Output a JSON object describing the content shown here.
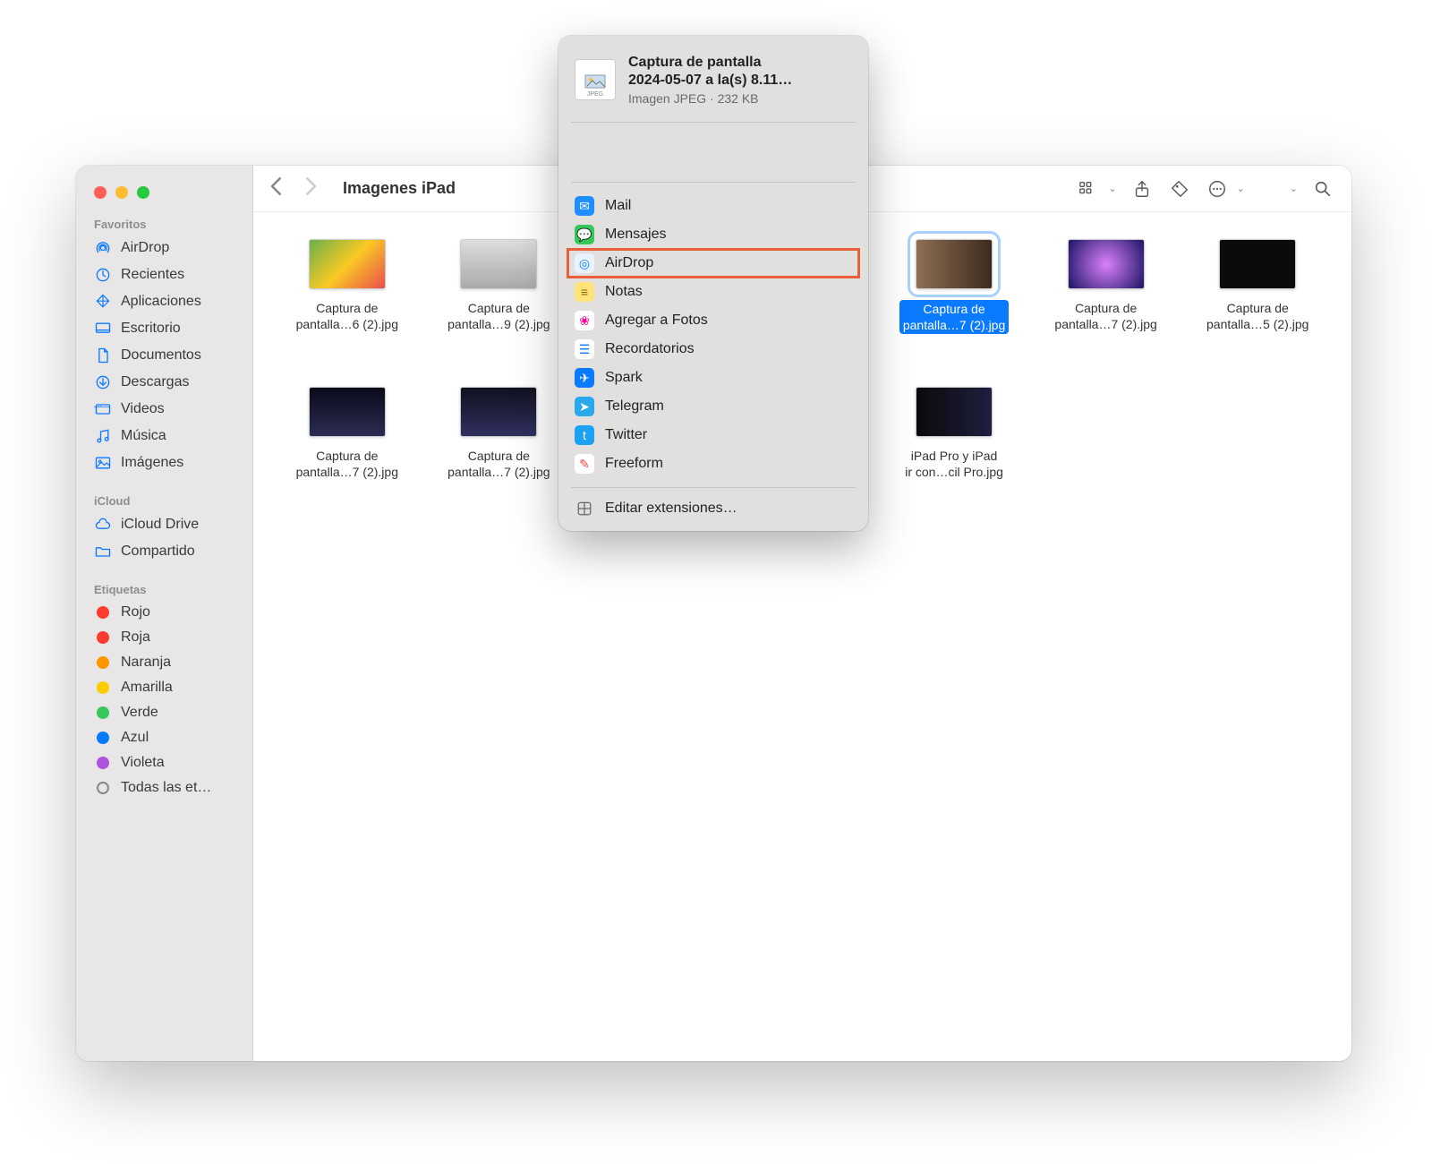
{
  "folder_title": "Imagenes iPad",
  "sidebar": {
    "favorites_label": "Favoritos",
    "icloud_label": "iCloud",
    "tags_label": "Etiquetas",
    "favorites": [
      {
        "label": "AirDrop",
        "icon": "airdrop"
      },
      {
        "label": "Recientes",
        "icon": "clock"
      },
      {
        "label": "Aplicaciones",
        "icon": "apps"
      },
      {
        "label": "Escritorio",
        "icon": "desktop"
      },
      {
        "label": "Documentos",
        "icon": "doc"
      },
      {
        "label": "Descargas",
        "icon": "download"
      },
      {
        "label": "Videos",
        "icon": "video"
      },
      {
        "label": "Música",
        "icon": "music"
      },
      {
        "label": "Imágenes",
        "icon": "images"
      }
    ],
    "icloud": [
      {
        "label": "iCloud Drive",
        "icon": "cloud"
      },
      {
        "label": "Compartido",
        "icon": "folder-shared"
      }
    ],
    "tags": [
      {
        "label": "Rojo",
        "color": "#ff3b30"
      },
      {
        "label": "Roja",
        "color": "#ff3b30"
      },
      {
        "label": "Naranja",
        "color": "#ff9500"
      },
      {
        "label": "Amarilla",
        "color": "#ffcc00"
      },
      {
        "label": "Verde",
        "color": "#34c759"
      },
      {
        "label": "Azul",
        "color": "#007aff"
      },
      {
        "label": "Violeta",
        "color": "#af52de"
      }
    ],
    "all_tags_label": "Todas las et…"
  },
  "files": [
    {
      "label": "Captura de\npantalla…6 (2).jpg",
      "thumb": "thumb-rainbow"
    },
    {
      "label": "Captura de\npantalla…9 (2).jpg",
      "thumb": "thumb-light"
    },
    {
      "label": "",
      "thumb": ""
    },
    {
      "label": "",
      "thumb": ""
    },
    {
      "label": "Captura de\npantalla…7 (2).jpg",
      "thumb": "thumb-person",
      "selected": true
    },
    {
      "label": "Captura de\npantalla…7 (2).jpg",
      "thumb": "thumb-purple"
    },
    {
      "label": "Captura de\npantalla…5 (2).jpg",
      "thumb": "thumb-dark2"
    },
    {
      "label": "Captura de\npantalla…7 (2).jpg",
      "thumb": "thumb-dark1"
    },
    {
      "label": "Captura de\npantalla…7 (2).jpg",
      "thumb": "thumb-dark3"
    },
    {
      "label": "",
      "thumb": ""
    },
    {
      "label": "",
      "thumb": ""
    },
    {
      "label": "iPad Pro y iPad\nir con…cil Pro.jpg",
      "thumb": "thumb-dark4"
    }
  ],
  "share": {
    "title": "Captura de pantalla\n2024-05-07 a la(s) 8.11…",
    "subtitle": "Imagen JPEG · 232 KB",
    "thumb_label": "JPEG",
    "apps": [
      {
        "label": "Mail",
        "color": "#1f8fff",
        "glyph": "✉"
      },
      {
        "label": "Mensajes",
        "color": "#34c759",
        "glyph": "💬"
      },
      {
        "label": "AirDrop",
        "color": "#e8f3ff",
        "glyph": "◎",
        "highlighted": true,
        "fg": "#0a7aff"
      },
      {
        "label": "Notas",
        "color": "#ffe27a",
        "glyph": "≡",
        "fg": "#8a6d00"
      },
      {
        "label": "Agregar a Fotos",
        "color": "#fff",
        "glyph": "❀",
        "fg": "#f09"
      },
      {
        "label": "Recordatorios",
        "color": "#fff",
        "glyph": "☰",
        "fg": "#0a7aff"
      },
      {
        "label": "Spark",
        "color": "#0a7aff",
        "glyph": "✈"
      },
      {
        "label": "Telegram",
        "color": "#29a9eb",
        "glyph": "➤"
      },
      {
        "label": "Twitter",
        "color": "#1da1f2",
        "glyph": "t"
      },
      {
        "label": "Freeform",
        "color": "#fff",
        "glyph": "✎",
        "fg": "#ff453a"
      }
    ],
    "edit_extensions": "Editar extensiones…"
  }
}
